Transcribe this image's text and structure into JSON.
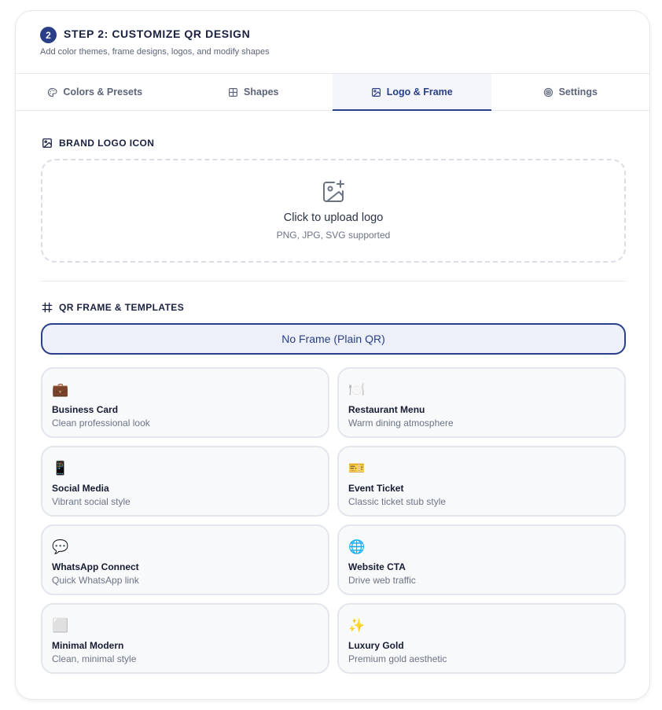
{
  "header": {
    "step_number": "2",
    "title": "STEP 2: CUSTOMIZE QR DESIGN",
    "subtitle": "Add color themes, frame designs, logos, and modify shapes"
  },
  "tabs": [
    {
      "label": "Colors & Presets",
      "icon": "palette-icon",
      "active": false
    },
    {
      "label": "Shapes",
      "icon": "grid-icon",
      "active": false
    },
    {
      "label": "Logo & Frame",
      "icon": "image-icon",
      "active": true
    },
    {
      "label": "Settings",
      "icon": "target-icon",
      "active": false
    }
  ],
  "logo_section": {
    "label": "BRAND LOGO ICON",
    "upload_title": "Click to upload logo",
    "upload_hint": "PNG, JPG, SVG supported"
  },
  "frame_section": {
    "label": "QR FRAME & TEMPLATES",
    "no_frame_label": "No Frame (Plain QR)",
    "templates": [
      {
        "emoji": "💼",
        "name": "Business Card",
        "desc": "Clean professional look"
      },
      {
        "emoji": "🍽️",
        "name": "Restaurant Menu",
        "desc": "Warm dining atmosphere"
      },
      {
        "emoji": "📱",
        "name": "Social Media",
        "desc": "Vibrant social style"
      },
      {
        "emoji": "🎫",
        "name": "Event Ticket",
        "desc": "Classic ticket stub style"
      },
      {
        "emoji": "💬",
        "name": "WhatsApp Connect",
        "desc": "Quick WhatsApp link"
      },
      {
        "emoji": "🌐",
        "name": "Website CTA",
        "desc": "Drive web traffic"
      },
      {
        "emoji": "⬜",
        "name": "Minimal Modern",
        "desc": "Clean, minimal style"
      },
      {
        "emoji": "✨",
        "name": "Luxury Gold",
        "desc": "Premium gold aesthetic"
      }
    ]
  },
  "colors": {
    "accent": "#2a3f87",
    "muted_text": "#6b7385",
    "border": "#e3e6ed"
  }
}
